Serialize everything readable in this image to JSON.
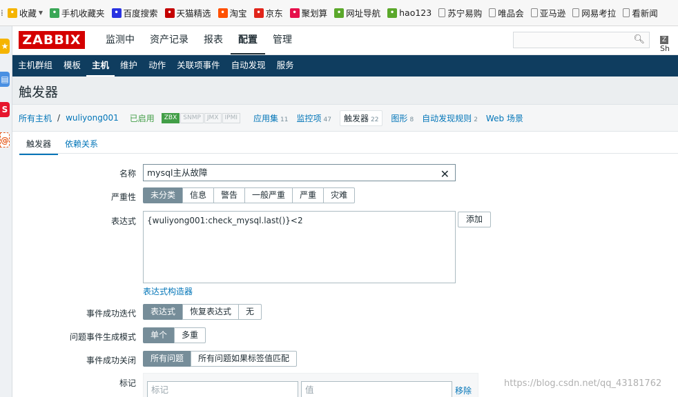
{
  "browser": {
    "bookmarks": [
      {
        "label": "收藏",
        "icon": "star-icon",
        "color": "#f5b400"
      },
      {
        "label": "手机收藏夹",
        "icon": "phone-icon",
        "color": "#3aa757"
      },
      {
        "label": "百度搜索",
        "icon": "baidu-paw-icon",
        "color": "#2932e1"
      },
      {
        "label": "天猫精选",
        "icon": "tmall-icon",
        "color": "#c40000"
      },
      {
        "label": "淘宝",
        "icon": "taobao-icon",
        "color": "#ff5000"
      },
      {
        "label": "京东",
        "icon": "jd-icon",
        "color": "#e1251b"
      },
      {
        "label": "聚划算",
        "icon": "juhuasuan-icon",
        "color": "#e60f4b"
      },
      {
        "label": "网址导航",
        "icon": "hao-icon",
        "color": "#5ba82b"
      },
      {
        "label": "hao123",
        "icon": "hao123-icon",
        "color": "#5ba82b"
      },
      {
        "label": "苏宁易购",
        "icon": "page-icon",
        "color": "#888888"
      },
      {
        "label": "唯品会",
        "icon": "page-icon",
        "color": "#888888"
      },
      {
        "label": "亚马逊",
        "icon": "page-icon",
        "color": "#888888"
      },
      {
        "label": "网易考拉",
        "icon": "page-icon",
        "color": "#888888"
      },
      {
        "label": "看新闻",
        "icon": "page-icon",
        "color": "#888888"
      }
    ]
  },
  "header": {
    "logo": "ZABBIX",
    "menu": [
      "监测中",
      "资产记录",
      "报表",
      "配置",
      "管理"
    ],
    "active_menu": "配置",
    "search_value": "",
    "share_label": "Sh"
  },
  "submenu": {
    "items": [
      "主机群组",
      "模板",
      "主机",
      "维护",
      "动作",
      "关联项事件",
      "自动发现",
      "服务"
    ],
    "active": "主机"
  },
  "page": {
    "title": "触发器"
  },
  "host_nav": {
    "all_hosts": "所有主机",
    "separator": "/",
    "host": "wuliyong001",
    "status": "已启用",
    "availability": [
      "ZBX",
      "SNMP",
      "JMX",
      "IPMI"
    ],
    "links": [
      {
        "label": "应用集",
        "count": "11"
      },
      {
        "label": "监控项",
        "count": "47"
      },
      {
        "label": "触发器",
        "count": "22"
      },
      {
        "label": "图形",
        "count": "8"
      },
      {
        "label": "自动发现规则",
        "count": "2"
      },
      {
        "label": "Web 场景",
        "count": ""
      }
    ]
  },
  "form": {
    "tabs": [
      "触发器",
      "依赖关系"
    ],
    "name_label": "名称",
    "name_value": "mysql主从故障",
    "severity_label": "严重性",
    "severity_options": [
      "未分类",
      "信息",
      "警告",
      "一般严重",
      "严重",
      "灾难"
    ],
    "severity_selected": "未分类",
    "expression_label": "表达式",
    "expression_value": "{wuliyong001:check_mysql.last()}<2",
    "add_button": "添加",
    "expression_builder": "表达式构造器",
    "ok_event_label": "事件成功迭代",
    "ok_event_options": [
      "表达式",
      "恢复表达式",
      "无"
    ],
    "ok_event_selected": "表达式",
    "problem_mode_label": "问题事件生成模式",
    "problem_mode_options": [
      "单个",
      "多重"
    ],
    "problem_mode_selected": "单个",
    "ok_close_label": "事件成功关闭",
    "ok_close_options": [
      "所有问题",
      "所有问题如果标签值匹配"
    ],
    "ok_close_selected": "所有问题",
    "tags_label": "标记",
    "tag_placeholder": "标记",
    "value_placeholder": "值",
    "remove_link": "移除"
  },
  "watermark": "https://blog.csdn.net/qq_43181762"
}
